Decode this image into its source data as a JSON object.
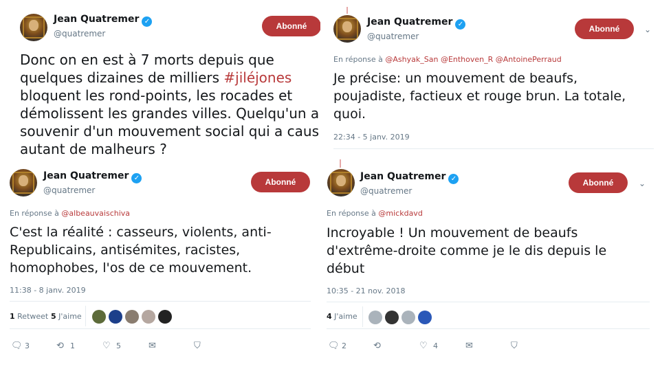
{
  "colors": {
    "accent": "#b8393a",
    "verified": "#1da1f2",
    "muted": "#657786"
  },
  "tweets": [
    {
      "name": "Jean Quatremer",
      "handle": "@quatremer",
      "follow_label": "Abonné",
      "text_lines": [
        "Donc on en est à 7 morts depuis que",
        "quelques dizaines de milliers ",
        "bloquent les rond-points, les rocades et",
        "démolissent les grandes villes. Quelqu'un a",
        "souvenir d'un mouvement social qui a caus",
        "autant de malheurs ?"
      ],
      "hashtag": "#jiléjones"
    },
    {
      "name": "Jean Quatremer",
      "handle": "@quatremer",
      "follow_label": "Abonné",
      "reply_prefix": "En réponse à ",
      "reply_users": [
        "@Ashyak_San",
        "@Enthoven_R",
        "@AntoinePerraud"
      ],
      "text_lines": [
        "Je précise: un mouvement de beaufs,",
        "poujadiste, factieux et rouge brun. La totale,",
        "quoi."
      ],
      "timestamp": "22:34 - 5 janv. 2019"
    },
    {
      "name": "Jean Quatremer",
      "handle": "@quatremer",
      "follow_label": "Abonné",
      "reply_prefix": "En réponse à ",
      "reply_users": [
        "@albeauvaischiva"
      ],
      "text_lines": [
        "C'est la réalité : casseurs, violents, anti-",
        "Republicains, antisémites, racistes,",
        "homophobes, l'os de ce mouvement."
      ],
      "timestamp": "11:38 - 8 janv. 2019",
      "retweets_count": "1",
      "retweets_label": "Retweet",
      "likes_count": "5",
      "likes_label": "J'aime",
      "actions": {
        "reply": "3",
        "retweet": "1",
        "like": "5"
      }
    },
    {
      "name": "Jean Quatremer",
      "handle": "@quatremer",
      "follow_label": "Abonné",
      "reply_prefix": "En réponse à ",
      "reply_users": [
        "@mickdavd"
      ],
      "text_lines": [
        "Incroyable ! Un mouvement de beaufs",
        "d'extrême-droite comme je le dis depuis le",
        "début"
      ],
      "timestamp": "10:35 - 21 nov. 2018",
      "likes_count": "4",
      "likes_label": "J'aime",
      "actions": {
        "reply": "2",
        "retweet": "",
        "like": "4"
      }
    }
  ],
  "icons": {
    "verified": "verified-badge-icon",
    "reply": "reply-icon",
    "retweet": "retweet-icon",
    "like": "heart-icon",
    "dm": "envelope-icon",
    "save": "bookmark-shield-icon",
    "more": "chevron-down-icon"
  }
}
